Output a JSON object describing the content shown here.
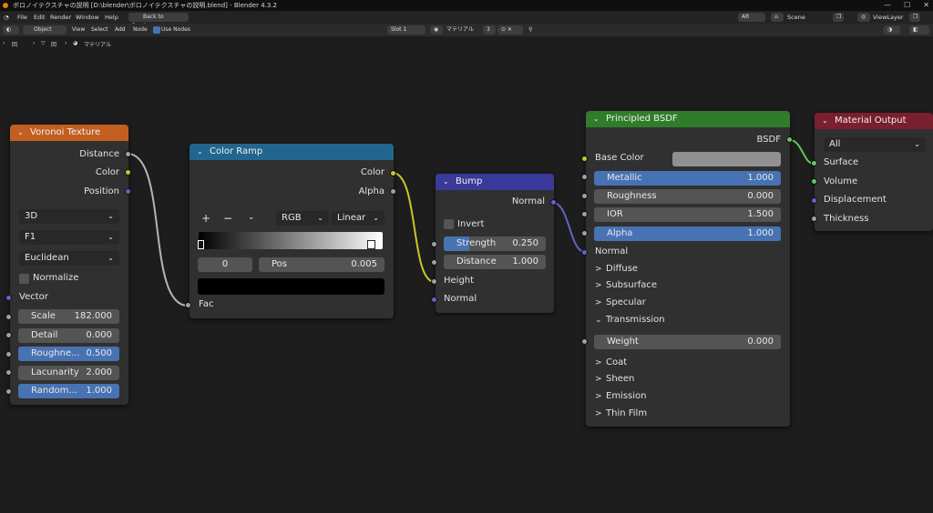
{
  "app": {
    "title": "ボロノイテクスチャの説明 [D:\\blender\\ボロノイテクスチャの説明.blend] - Blender 4.3.2",
    "menu": [
      "File",
      "Edit",
      "Render",
      "Window",
      "Help"
    ],
    "back_button": "Back to Previous",
    "scene": "Scene",
    "view_layer": "ViewLayer",
    "lang": "AR"
  },
  "header": {
    "mode": "Object",
    "menu": [
      "View",
      "Select",
      "Add",
      "Node"
    ],
    "use_nodes": "Use Nodes",
    "slot": "Slot 1",
    "material": "マテリアル",
    "users": "3"
  },
  "breadcrumb": [
    "回",
    "回",
    "マテリアル"
  ],
  "voronoi": {
    "title": "Voronoi Texture",
    "outputs": [
      "Distance",
      "Color",
      "Position"
    ],
    "dims": "3D",
    "feature": "F1",
    "metric": "Euclidean",
    "normalize": "Normalize",
    "vector": "Vector",
    "fields": [
      {
        "label": "Scale",
        "value": "182.000"
      },
      {
        "label": "Detail",
        "value": "0.000"
      },
      {
        "label": "Roughne...",
        "value": "0.500"
      },
      {
        "label": "Lacunarity",
        "value": "2.000"
      },
      {
        "label": "Random...",
        "value": "1.000"
      }
    ]
  },
  "color_ramp": {
    "title": "Color Ramp",
    "outputs": [
      "Color",
      "Alpha"
    ],
    "plus": "+",
    "minus": "−",
    "color_mode": "RGB",
    "interp": "Linear",
    "index": "0",
    "pos_label": "Pos",
    "pos_value": "0.005",
    "fac": "Fac"
  },
  "bump": {
    "title": "Bump",
    "output": "Normal",
    "invert": "Invert",
    "strength_label": "Strength",
    "strength_value": "0.250",
    "strength_fraction": 0.25,
    "distance_label": "Distance",
    "distance_value": "1.000",
    "height": "Height",
    "normal": "Normal"
  },
  "bsdf": {
    "title": "Principled BSDF",
    "output": "BSDF",
    "base_color": "Base Color",
    "fields": [
      {
        "label": "Metallic",
        "value": "1.000"
      },
      {
        "label": "Roughness",
        "value": "0.000"
      },
      {
        "label": "IOR",
        "value": "1.500"
      },
      {
        "label": "Alpha",
        "value": "1.000"
      }
    ],
    "normal": "Normal",
    "panels": [
      "Diffuse",
      "Subsurface",
      "Specular",
      "Transmission"
    ],
    "weight_label": "Weight",
    "weight_value": "0.000",
    "panels2": [
      "Coat",
      "Sheen",
      "Emission",
      "Thin Film"
    ]
  },
  "output": {
    "title": "Material Output",
    "target": "All",
    "inputs": [
      "Surface",
      "Volume",
      "Displacement",
      "Thickness"
    ]
  },
  "colors": {
    "texture_header": "#c25f20",
    "converter_header": "#22668f",
    "vector_header": "#3a3a9a",
    "shader_header": "#2f7d2a",
    "output_header": "#7a1f2e"
  }
}
